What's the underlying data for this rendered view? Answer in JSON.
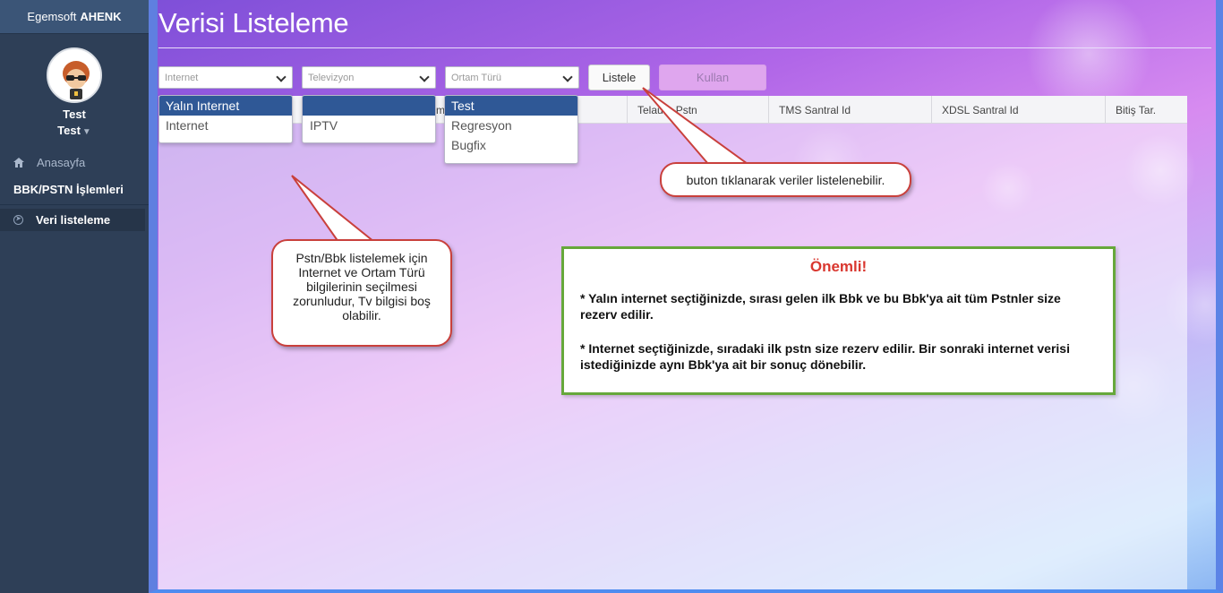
{
  "sidebar": {
    "brand_prefix": "Egemsoft",
    "brand_name": "AHENK",
    "user_name": "Test",
    "user_role": "Test",
    "home_label": "Anasayfa",
    "section_label": "BBK/PSTN İşlemleri",
    "active_item": "Veri listeleme"
  },
  "page": {
    "title": "Verisi Listeleme"
  },
  "filters": {
    "internet_placeholder": "Internet",
    "tv_placeholder": "Televizyon",
    "ortam_placeholder": "Ortam Türü",
    "listele_label": "Listele",
    "kullan_label": "Kullan",
    "internet_options": [
      "Yalın Internet",
      "Internet"
    ],
    "tv_options": [
      "",
      "IPTV"
    ],
    "ortam_options": [
      "Test",
      "Regresyon",
      "Bugfix"
    ]
  },
  "table": {
    "columns": [
      "Telaura Pstn",
      "TMS Santral Id",
      "XDSL Santral Id",
      "Bitiş Tar."
    ],
    "hidden_col_fragment": "m",
    "telaura_partial": "Telaura Pstn"
  },
  "callouts": {
    "button_hint": "buton tıklanarak veriler listelenebilir.",
    "filter_hint": "Pstn/Bbk listelemek için Internet ve Ortam Türü bilgilerinin seçilmesi zorunludur, Tv bilgisi boş olabilir."
  },
  "notice": {
    "title": "Önemli!",
    "line1": "* Yalın internet seçtiğinizde, sırası gelen ilk Bbk ve bu Bbk'ya ait tüm Pstnler size rezerv edilir.",
    "line2": "* Internet seçtiğinizde, sıradaki ilk pstn size rezerv edilir. Bir sonraki internet verisi istediğinizde aynı Bbk'ya ait bir sonuç dönebilir."
  },
  "colors": {
    "sidebar_bg": "#2e3f57",
    "selected_option_bg": "#2f5896",
    "callout_border": "#c9403c",
    "notice_border": "#66a83b",
    "notice_title": "#d9372f"
  }
}
